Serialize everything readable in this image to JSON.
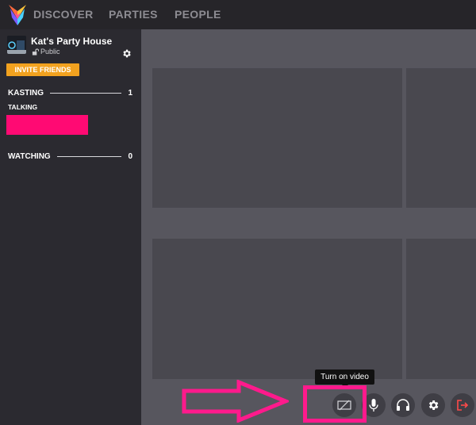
{
  "nav": {
    "items": [
      "DISCOVER",
      "PARTIES",
      "PEOPLE"
    ]
  },
  "room": {
    "title": "Kat's Party House",
    "privacy": "Public",
    "invite_label": "INVITE FRIENDS"
  },
  "sections": {
    "kasting": {
      "label": "KASTING",
      "count": "1"
    },
    "talking_label": "TALKING",
    "watching": {
      "label": "WATCHING",
      "count": "0"
    }
  },
  "controls": {
    "tooltip": "Turn on video",
    "icons": [
      "video-off-icon",
      "microphone-icon",
      "headphones-icon",
      "gear-icon",
      "leave-icon"
    ]
  },
  "colors": {
    "accent": "#f2a21f",
    "highlight": "#ff1a8c",
    "leave": "#ff4a4a"
  }
}
